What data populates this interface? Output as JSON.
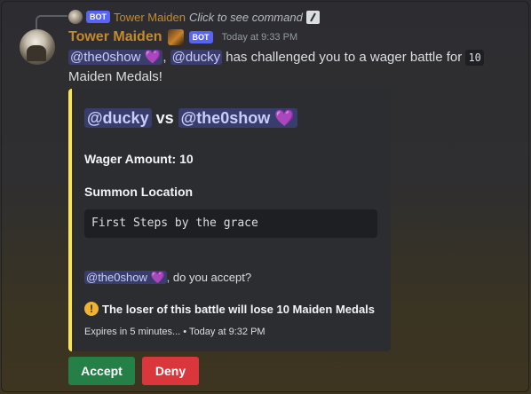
{
  "reply": {
    "bot_tag": "BOT",
    "author": "Tower Maiden",
    "command_hint": "Click to see command"
  },
  "message": {
    "author": "Tower Maiden",
    "bot_tag": "BOT",
    "timestamp": "Today at 9:33 PM",
    "mention_1": "@the0show",
    "mention_1_heart": "💜",
    "separator": ",",
    "mention_2": "@ducky",
    "text_1": "has challenged you to a wager battle for",
    "amount": "10",
    "text_2": "Maiden Medals!"
  },
  "embed": {
    "accent_color": "#fbe54c",
    "title_left": "@ducky",
    "title_vs": "vs",
    "title_right": "@the0show",
    "title_heart": "💜",
    "wager_label": "Wager Amount: 10",
    "location_label": "Summon Location",
    "location_value": "First Steps by the grace",
    "accept_mention": "@the0show",
    "accept_heart": "💜",
    "accept_text": ", do you accept?",
    "warning_icon": "!",
    "warning_text": "The loser of this battle will lose 10 Maiden Medals",
    "footer": "Expires in 5 minutes... • Today at 9:32 PM"
  },
  "buttons": {
    "accept": "Accept",
    "deny": "Deny"
  }
}
